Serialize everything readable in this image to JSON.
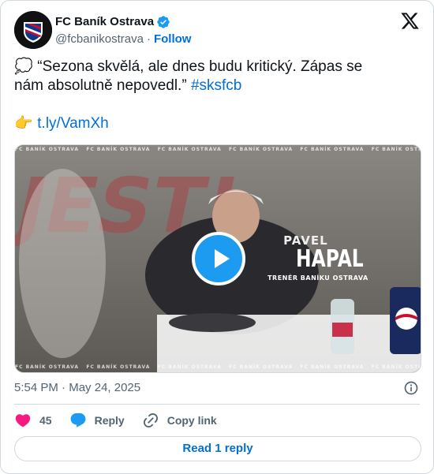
{
  "author": {
    "display_name": "FC Baník Ostrava",
    "handle": "@fcbanikostrava",
    "separator": "·",
    "follow_label": "Follow"
  },
  "tweet": {
    "line1": "“Sezona skvělá, ale dnes budu kritický. Zápas se",
    "line2_text": "nám absolutně nepovedl.”",
    "hashtag": "#sksfcb",
    "link": "t.ly/VamXh",
    "emoji_thought": "💭",
    "emoji_point": "👉"
  },
  "video": {
    "overlay_first_name": "PAVEL",
    "overlay_last_name": "HAPAL",
    "overlay_role": "TRENÉR BANÍKU OSTRAVA",
    "ticker_text": "FC BANÍK OSTRAVA",
    "watermark_text": "JEST!"
  },
  "meta": {
    "time": "5:54 PM",
    "separator": "·",
    "date": "May 24, 2025"
  },
  "actions": {
    "like_count": "45",
    "reply_label": "Reply",
    "copy_label": "Copy link"
  },
  "footer": {
    "read_replies_label": "Read 1 reply"
  },
  "colors": {
    "accent": "#1d9bf0",
    "link": "#006fd6",
    "like": "#f91880",
    "club_red": "#c8102e",
    "club_blue": "#0b3a8c"
  }
}
